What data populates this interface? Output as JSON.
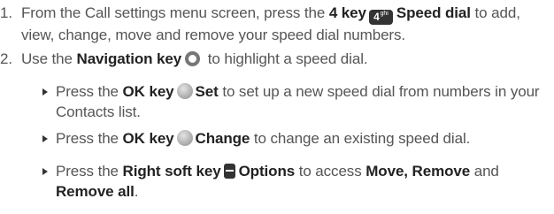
{
  "steps": [
    {
      "num": "1.",
      "t1": "From the Call settings menu screen, press the ",
      "k1": "4 key",
      "icon_label": "4",
      "icon_sub": "ghi",
      "k2": "Speed dial",
      "t2": " to add, view, change, move and remove your speed dial numbers."
    },
    {
      "num": "2.",
      "t1": "Use the ",
      "k1": "Navigation key",
      "t2": " to highlight a speed dial."
    }
  ],
  "bullets": [
    {
      "t1": "Press the ",
      "k1": "OK key",
      "k2": "Set",
      "t2": " to set up a new speed dial from numbers in your Contacts list."
    },
    {
      "t1": "Press the ",
      "k1": "OK key",
      "k2": "Change",
      "t2": " to change an existing speed dial."
    },
    {
      "t1": "Press the ",
      "k1": "Right soft key",
      "k2": "Options",
      "t2": " to access ",
      "k3": "Move, Remove",
      "t3": " and ",
      "k4": "Remove all",
      "t4": "."
    }
  ],
  "icons": {
    "four_key": "keypad-4-key-icon",
    "navigation_key": "navigation-ring-icon",
    "ok_key": "ok-key-icon",
    "right_soft_key": "right-soft-key-icon"
  },
  "colors": {
    "text": "#555555",
    "emphasis": "#222222",
    "key_fill": "#333333"
  }
}
